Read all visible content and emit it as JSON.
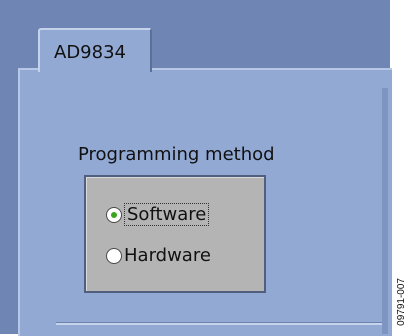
{
  "window": {
    "tab_label": "AD9834"
  },
  "programming_method": {
    "title": "Programming method",
    "options": [
      {
        "label": "Software",
        "selected": true
      },
      {
        "label": "Hardware",
        "selected": false
      }
    ]
  },
  "figure_code": "09791-007",
  "colors": {
    "frame": "#6f86b4",
    "panel": "#92a9d3",
    "group_box": "#b4b4b4",
    "radio_dot": "#3aa51f"
  }
}
